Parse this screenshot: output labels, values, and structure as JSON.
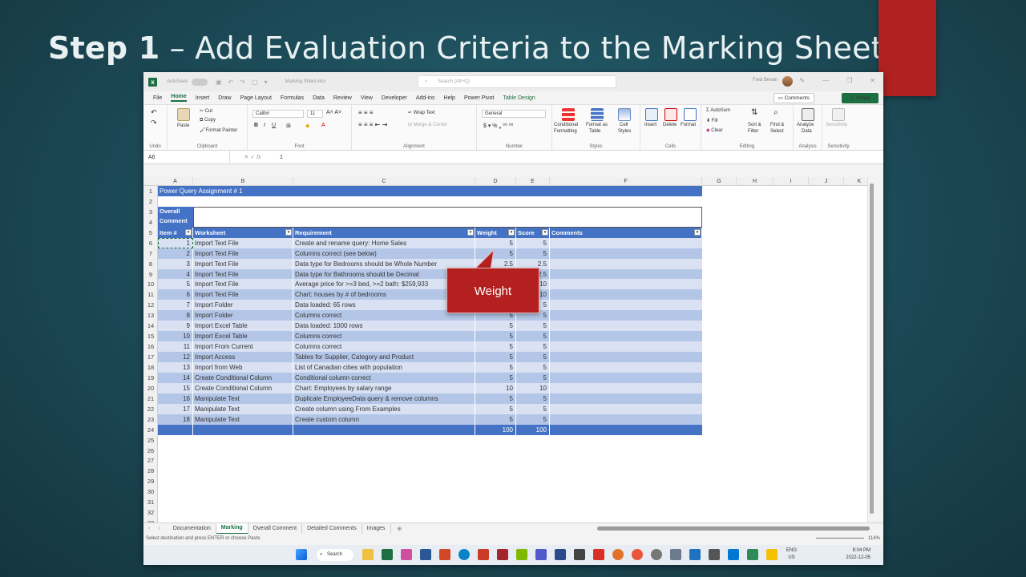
{
  "slide": {
    "title_bold": "Step 1",
    "title_rest": " – Add Evaluation Criteria to the Marking Sheet",
    "callout": "Weight"
  },
  "excel": {
    "titlebar": {
      "autosave": "AutoSave",
      "filename": "Marking Sheet.xlsx",
      "search_placeholder": "Search (Alt+Q)",
      "user": "Fred Bevan"
    },
    "tabs": [
      "File",
      "Home",
      "Insert",
      "Draw",
      "Page Layout",
      "Formulas",
      "Data",
      "Review",
      "View",
      "Developer",
      "Add-ins",
      "Help",
      "Power Pivot",
      "Table Design"
    ],
    "comments_btn": "Comments",
    "share_btn": "Share",
    "ribbon": {
      "undo": "Undo",
      "clipboard": {
        "label": "Clipboard",
        "paste": "Paste",
        "cut": "Cut",
        "copy": "Copy",
        "format_painter": "Format Painter"
      },
      "font": {
        "label": "Font",
        "name": "Calibri",
        "size": "11"
      },
      "alignment": {
        "label": "Alignment",
        "wrap": "Wrap Text",
        "merge": "Merge & Center"
      },
      "number": {
        "label": "Number",
        "format": "General"
      },
      "styles": {
        "label": "Styles",
        "cond": "Conditional Formatting",
        "cond_l1": "Conditional",
        "cond_l2": "Formatting",
        "fmt_table_l1": "Format as",
        "fmt_table_l2": "Table",
        "cell_styles_l1": "Cell",
        "cell_styles_l2": "Styles"
      },
      "cells": {
        "label": "Cells",
        "insert": "Insert",
        "delete": "Delete",
        "format": "Format"
      },
      "editing": {
        "label": "Editing",
        "autosum": "AutoSum",
        "fill": "Fill",
        "clear": "Clear",
        "sort_l1": "Sort &",
        "sort_l2": "Filter",
        "find_l1": "Find &",
        "find_l2": "Select"
      },
      "analysis": {
        "label": "Analysis",
        "analyze_l1": "Analyze",
        "analyze_l2": "Data"
      },
      "sensitivity": {
        "label": "Sensitivity",
        "btn": "Sensitivity"
      }
    },
    "formula_bar": {
      "namebox": "A6",
      "value": "1"
    },
    "columns": [
      "A",
      "B",
      "C",
      "D",
      "E",
      "F",
      "G",
      "H",
      "I",
      "J",
      "K"
    ],
    "sheet": {
      "title": "Power Query Assignment # 1",
      "overall_comment_l1": "Overall",
      "overall_comment_l2": "Comment",
      "headers": [
        "Item #",
        "Worksheet",
        "Requirement",
        "Weight",
        "Score",
        "Comments"
      ],
      "rows": [
        {
          "item": "1",
          "worksheet": "Import Text File",
          "requirement": "Create and rename query: Home Sales",
          "weight": "5",
          "score": "5"
        },
        {
          "item": "2",
          "worksheet": "Import Text File",
          "requirement": "Columns correct (see below)",
          "weight": "5",
          "score": "5"
        },
        {
          "item": "3",
          "worksheet": "Import Text File",
          "requirement": "Data type for Bedrooms should be Whole Number",
          "weight": "2.5",
          "score": "2.5"
        },
        {
          "item": "4",
          "worksheet": "Import Text File",
          "requirement": "Data type for Bathrooms should be Decimal",
          "weight": "",
          "score": "2.5"
        },
        {
          "item": "5",
          "worksheet": "Import Text File",
          "requirement": "Average price for >=3 bed, >=2 bath: $259,933",
          "weight": "",
          "score": "10"
        },
        {
          "item": "6",
          "worksheet": "Import Text File",
          "requirement": "Chart: houses by # of bedrooms",
          "weight": "",
          "score": "10"
        },
        {
          "item": "7",
          "worksheet": "Import Folder",
          "requirement": "Data loaded: 65 rows",
          "weight": "",
          "score": "5"
        },
        {
          "item": "8",
          "worksheet": "Import Folder",
          "requirement": "Columns correct",
          "weight": "5",
          "score": "5"
        },
        {
          "item": "9",
          "worksheet": "Import Excel Table",
          "requirement": "Data loaded: 1000 rows",
          "weight": "5",
          "score": "5"
        },
        {
          "item": "10",
          "worksheet": "Import Excel Table",
          "requirement": "Columns correct",
          "weight": "5",
          "score": "5"
        },
        {
          "item": "11",
          "worksheet": "Import From Current",
          "requirement": "Columns correct",
          "weight": "5",
          "score": "5"
        },
        {
          "item": "12",
          "worksheet": "Import Access",
          "requirement": "Tables for Supplier, Category and Product",
          "weight": "5",
          "score": "5"
        },
        {
          "item": "13",
          "worksheet": "Import from Web",
          "requirement": "List of Canadian cities with population",
          "weight": "5",
          "score": "5"
        },
        {
          "item": "14",
          "worksheet": "Create Conditional Column",
          "requirement": "Conditional column correct",
          "weight": "5",
          "score": "5"
        },
        {
          "item": "15",
          "worksheet": "Create Conditional Column",
          "requirement": "Chart: Employees by salary range",
          "weight": "10",
          "score": "10"
        },
        {
          "item": "16",
          "worksheet": "Manipulate Text",
          "requirement": "Duplicate EmployeeData query & remove columns",
          "weight": "5",
          "score": "5"
        },
        {
          "item": "17",
          "worksheet": "Manipulate Text",
          "requirement": "Create column using From Examples",
          "weight": "5",
          "score": "5"
        },
        {
          "item": "18",
          "worksheet": "Manipulate Text",
          "requirement": "Create custom column",
          "weight": "5",
          "score": "5"
        }
      ],
      "totals": {
        "weight": "100",
        "score": "100"
      }
    },
    "sheet_tabs": [
      "Documentation",
      "Marking",
      "Overall Comment",
      "Detailed Comments",
      "Images"
    ],
    "active_sheet": "Marking",
    "status": "Select destination and press ENTER or choose Paste",
    "zoom": "114%",
    "taskbar": {
      "search": "Search",
      "lang_l1": "ENG",
      "lang_l2": "US",
      "time": "8:04 PM",
      "date": "2022-12-05"
    }
  },
  "colors": {
    "table_header": "#4472c4",
    "band_dark": "#b4c6e7",
    "band_light": "#d9e1f2",
    "excel_green": "#1d6f42",
    "callout": "#b42020"
  }
}
